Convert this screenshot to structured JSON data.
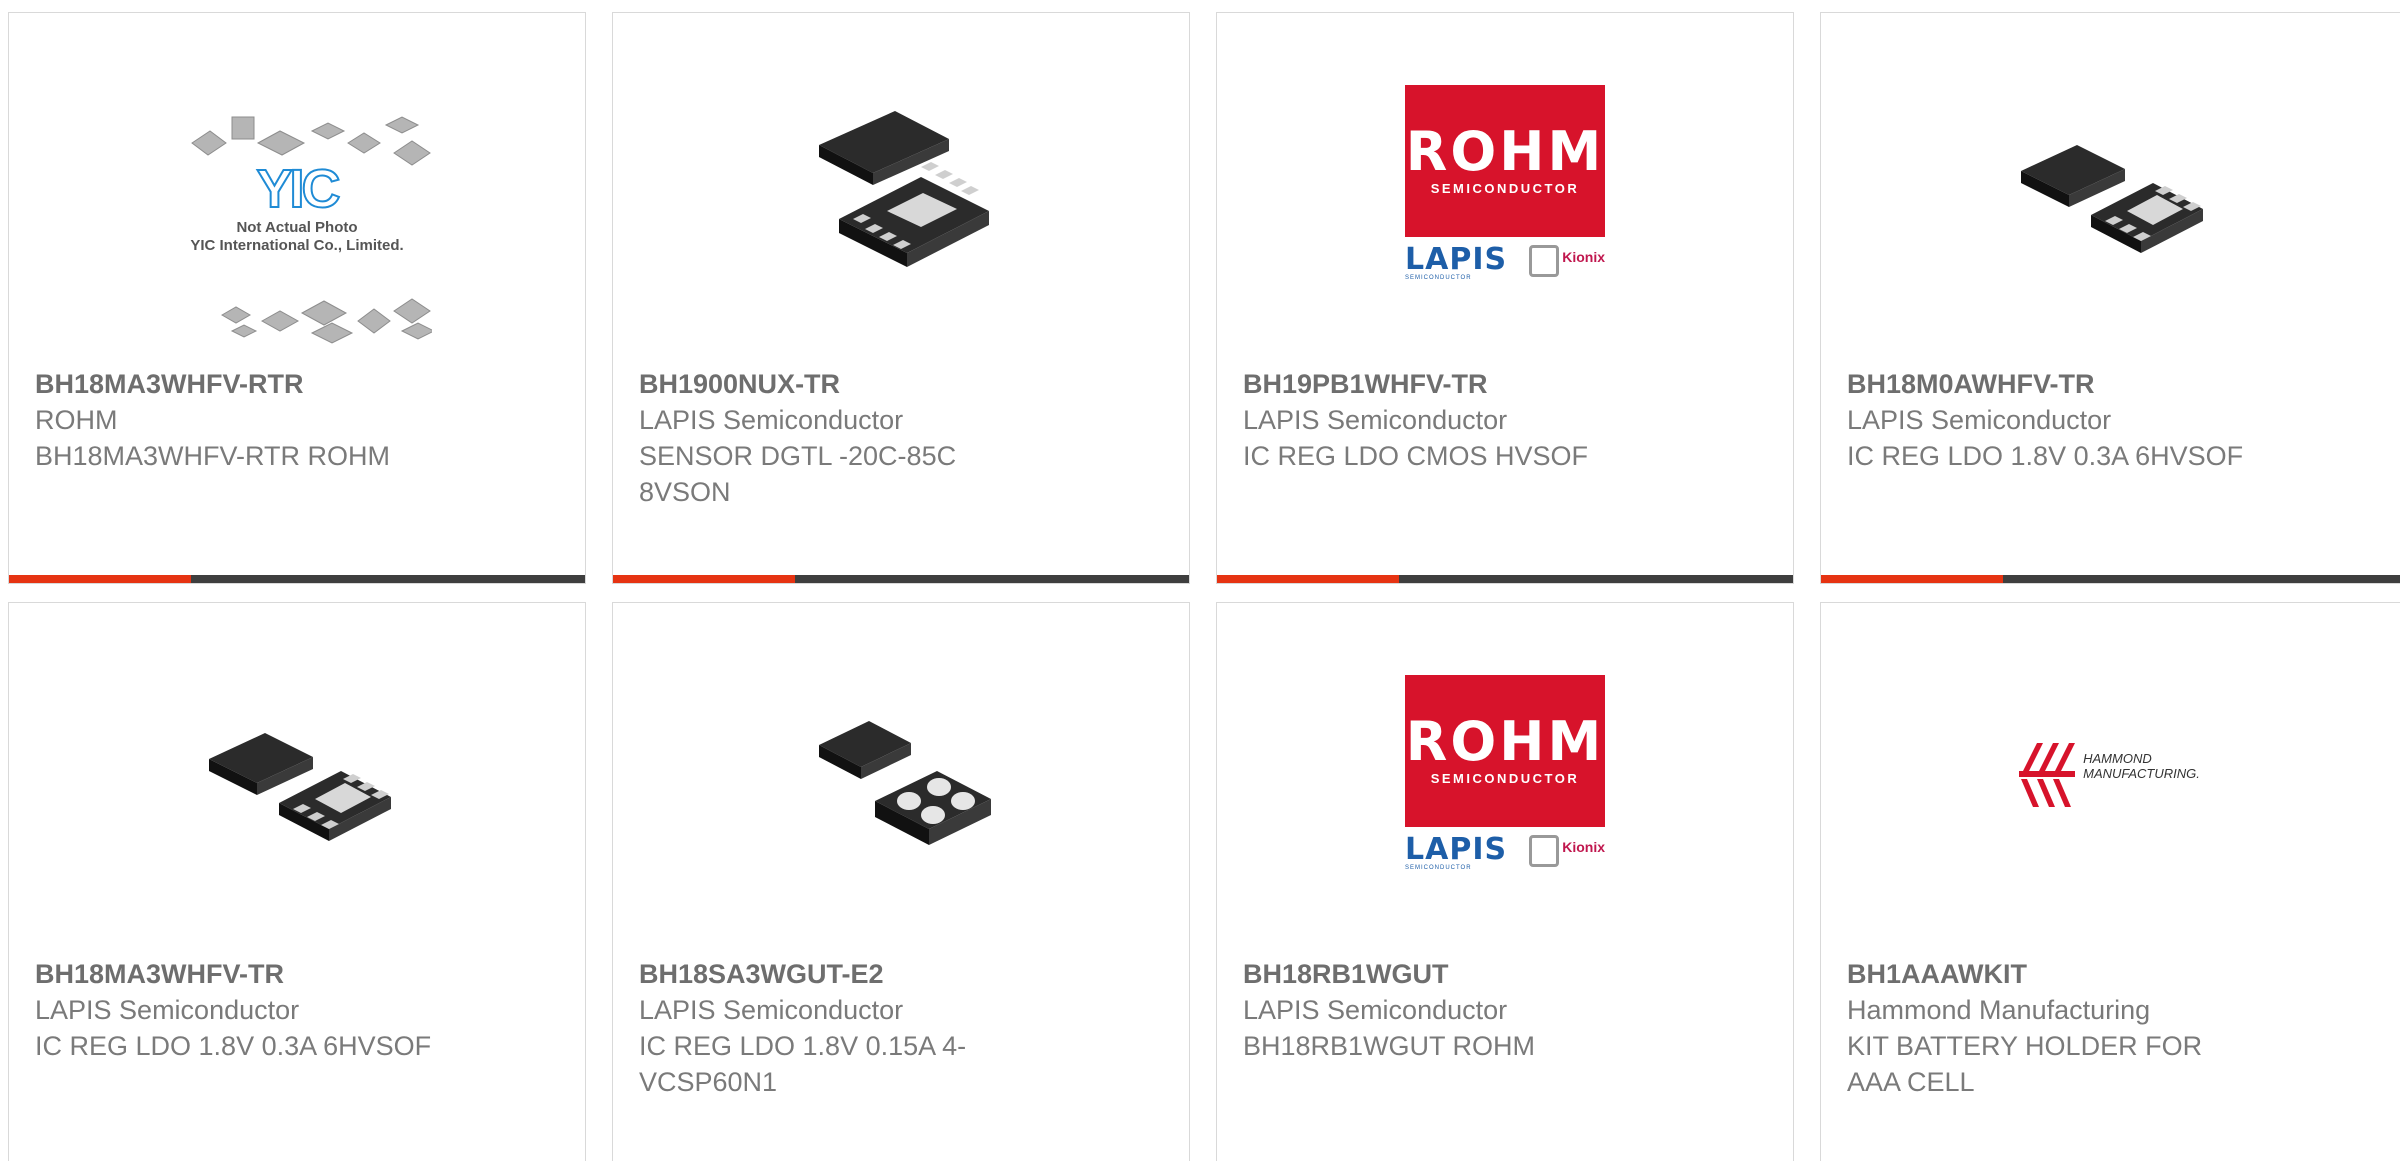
{
  "colors": {
    "accent": "#e63312",
    "bar": "#3e3e3e",
    "border": "#d9d9d9",
    "text": "#7a7a7a"
  },
  "products": [
    {
      "part": "BH18MA3WHFV-RTR",
      "manufacturer": "ROHM",
      "description": "BH18MA3WHFV-RTR ROHM",
      "image": "yic-placeholder",
      "image_text": [
        "Not Actual Photo",
        "YIC International Co., Limited."
      ],
      "logo_text": "YIC"
    },
    {
      "part": "BH1900NUX-TR",
      "manufacturer": "LAPIS Semiconductor",
      "description": "SENSOR DGTL -20C-85C 8VSON",
      "image": "chip-8pin-package"
    },
    {
      "part": "BH19PB1WHFV-TR",
      "manufacturer": "LAPIS Semiconductor",
      "description": "IC REG LDO CMOS HVSOF",
      "image": "rohm-logo",
      "logo": {
        "main": "ROHM",
        "sub": "SEMICONDUCTOR",
        "lapis": "LAPIS",
        "lapis_sub": "SEMICONDUCTOR",
        "kionix": "Kionix"
      }
    },
    {
      "part": "BH18M0AWHFV-TR",
      "manufacturer": "LAPIS Semiconductor",
      "description": "IC REG LDO 1.8V 0.3A 6HVSOF",
      "image": "chip-6pin-package"
    },
    {
      "part": "BH18MA3WHFV-TR",
      "manufacturer": "LAPIS Semiconductor",
      "description": "IC REG LDO 1.8V 0.3A 6HVSOF",
      "image": "chip-6pin-package"
    },
    {
      "part": "BH18SA3WGUT-E2",
      "manufacturer": "LAPIS Semiconductor",
      "description": "IC REG LDO 1.8V 0.15A 4-VCSP60N1",
      "image": "chip-4ball-package"
    },
    {
      "part": "BH18RB1WGUT",
      "manufacturer": "LAPIS Semiconductor",
      "description": "BH18RB1WGUT ROHM",
      "image": "rohm-logo",
      "logo": {
        "main": "ROHM",
        "sub": "SEMICONDUCTOR",
        "lapis": "LAPIS",
        "lapis_sub": "SEMICONDUCTOR",
        "kionix": "Kionix"
      }
    },
    {
      "part": "BH1AAAWKIT",
      "manufacturer": "Hammond Manufacturing",
      "description": "KIT BATTERY HOLDER FOR AAA CELL",
      "image": "hammond-logo",
      "logo_text": [
        "HAMMOND",
        "MANUFACTURING."
      ]
    }
  ]
}
